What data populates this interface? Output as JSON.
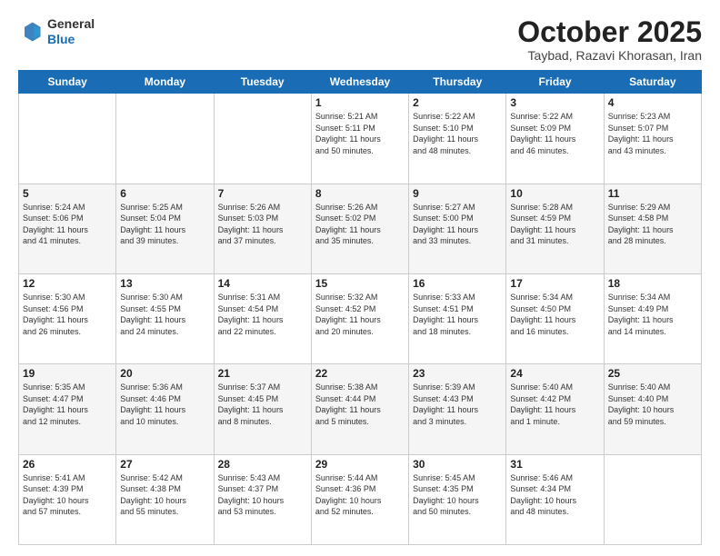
{
  "header": {
    "logo": {
      "line1": "General",
      "line2": "Blue"
    },
    "title": "October 2025",
    "location": "Taybad, Razavi Khorasan, Iran"
  },
  "weekdays": [
    "Sunday",
    "Monday",
    "Tuesday",
    "Wednesday",
    "Thursday",
    "Friday",
    "Saturday"
  ],
  "weeks": [
    [
      {
        "day": "",
        "info": ""
      },
      {
        "day": "",
        "info": ""
      },
      {
        "day": "",
        "info": ""
      },
      {
        "day": "1",
        "info": "Sunrise: 5:21 AM\nSunset: 5:11 PM\nDaylight: 11 hours\nand 50 minutes."
      },
      {
        "day": "2",
        "info": "Sunrise: 5:22 AM\nSunset: 5:10 PM\nDaylight: 11 hours\nand 48 minutes."
      },
      {
        "day": "3",
        "info": "Sunrise: 5:22 AM\nSunset: 5:09 PM\nDaylight: 11 hours\nand 46 minutes."
      },
      {
        "day": "4",
        "info": "Sunrise: 5:23 AM\nSunset: 5:07 PM\nDaylight: 11 hours\nand 43 minutes."
      }
    ],
    [
      {
        "day": "5",
        "info": "Sunrise: 5:24 AM\nSunset: 5:06 PM\nDaylight: 11 hours\nand 41 minutes."
      },
      {
        "day": "6",
        "info": "Sunrise: 5:25 AM\nSunset: 5:04 PM\nDaylight: 11 hours\nand 39 minutes."
      },
      {
        "day": "7",
        "info": "Sunrise: 5:26 AM\nSunset: 5:03 PM\nDaylight: 11 hours\nand 37 minutes."
      },
      {
        "day": "8",
        "info": "Sunrise: 5:26 AM\nSunset: 5:02 PM\nDaylight: 11 hours\nand 35 minutes."
      },
      {
        "day": "9",
        "info": "Sunrise: 5:27 AM\nSunset: 5:00 PM\nDaylight: 11 hours\nand 33 minutes."
      },
      {
        "day": "10",
        "info": "Sunrise: 5:28 AM\nSunset: 4:59 PM\nDaylight: 11 hours\nand 31 minutes."
      },
      {
        "day": "11",
        "info": "Sunrise: 5:29 AM\nSunset: 4:58 PM\nDaylight: 11 hours\nand 28 minutes."
      }
    ],
    [
      {
        "day": "12",
        "info": "Sunrise: 5:30 AM\nSunset: 4:56 PM\nDaylight: 11 hours\nand 26 minutes."
      },
      {
        "day": "13",
        "info": "Sunrise: 5:30 AM\nSunset: 4:55 PM\nDaylight: 11 hours\nand 24 minutes."
      },
      {
        "day": "14",
        "info": "Sunrise: 5:31 AM\nSunset: 4:54 PM\nDaylight: 11 hours\nand 22 minutes."
      },
      {
        "day": "15",
        "info": "Sunrise: 5:32 AM\nSunset: 4:52 PM\nDaylight: 11 hours\nand 20 minutes."
      },
      {
        "day": "16",
        "info": "Sunrise: 5:33 AM\nSunset: 4:51 PM\nDaylight: 11 hours\nand 18 minutes."
      },
      {
        "day": "17",
        "info": "Sunrise: 5:34 AM\nSunset: 4:50 PM\nDaylight: 11 hours\nand 16 minutes."
      },
      {
        "day": "18",
        "info": "Sunrise: 5:34 AM\nSunset: 4:49 PM\nDaylight: 11 hours\nand 14 minutes."
      }
    ],
    [
      {
        "day": "19",
        "info": "Sunrise: 5:35 AM\nSunset: 4:47 PM\nDaylight: 11 hours\nand 12 minutes."
      },
      {
        "day": "20",
        "info": "Sunrise: 5:36 AM\nSunset: 4:46 PM\nDaylight: 11 hours\nand 10 minutes."
      },
      {
        "day": "21",
        "info": "Sunrise: 5:37 AM\nSunset: 4:45 PM\nDaylight: 11 hours\nand 8 minutes."
      },
      {
        "day": "22",
        "info": "Sunrise: 5:38 AM\nSunset: 4:44 PM\nDaylight: 11 hours\nand 5 minutes."
      },
      {
        "day": "23",
        "info": "Sunrise: 5:39 AM\nSunset: 4:43 PM\nDaylight: 11 hours\nand 3 minutes."
      },
      {
        "day": "24",
        "info": "Sunrise: 5:40 AM\nSunset: 4:42 PM\nDaylight: 11 hours\nand 1 minute."
      },
      {
        "day": "25",
        "info": "Sunrise: 5:40 AM\nSunset: 4:40 PM\nDaylight: 10 hours\nand 59 minutes."
      }
    ],
    [
      {
        "day": "26",
        "info": "Sunrise: 5:41 AM\nSunset: 4:39 PM\nDaylight: 10 hours\nand 57 minutes."
      },
      {
        "day": "27",
        "info": "Sunrise: 5:42 AM\nSunset: 4:38 PM\nDaylight: 10 hours\nand 55 minutes."
      },
      {
        "day": "28",
        "info": "Sunrise: 5:43 AM\nSunset: 4:37 PM\nDaylight: 10 hours\nand 53 minutes."
      },
      {
        "day": "29",
        "info": "Sunrise: 5:44 AM\nSunset: 4:36 PM\nDaylight: 10 hours\nand 52 minutes."
      },
      {
        "day": "30",
        "info": "Sunrise: 5:45 AM\nSunset: 4:35 PM\nDaylight: 10 hours\nand 50 minutes."
      },
      {
        "day": "31",
        "info": "Sunrise: 5:46 AM\nSunset: 4:34 PM\nDaylight: 10 hours\nand 48 minutes."
      },
      {
        "day": "",
        "info": ""
      }
    ]
  ]
}
